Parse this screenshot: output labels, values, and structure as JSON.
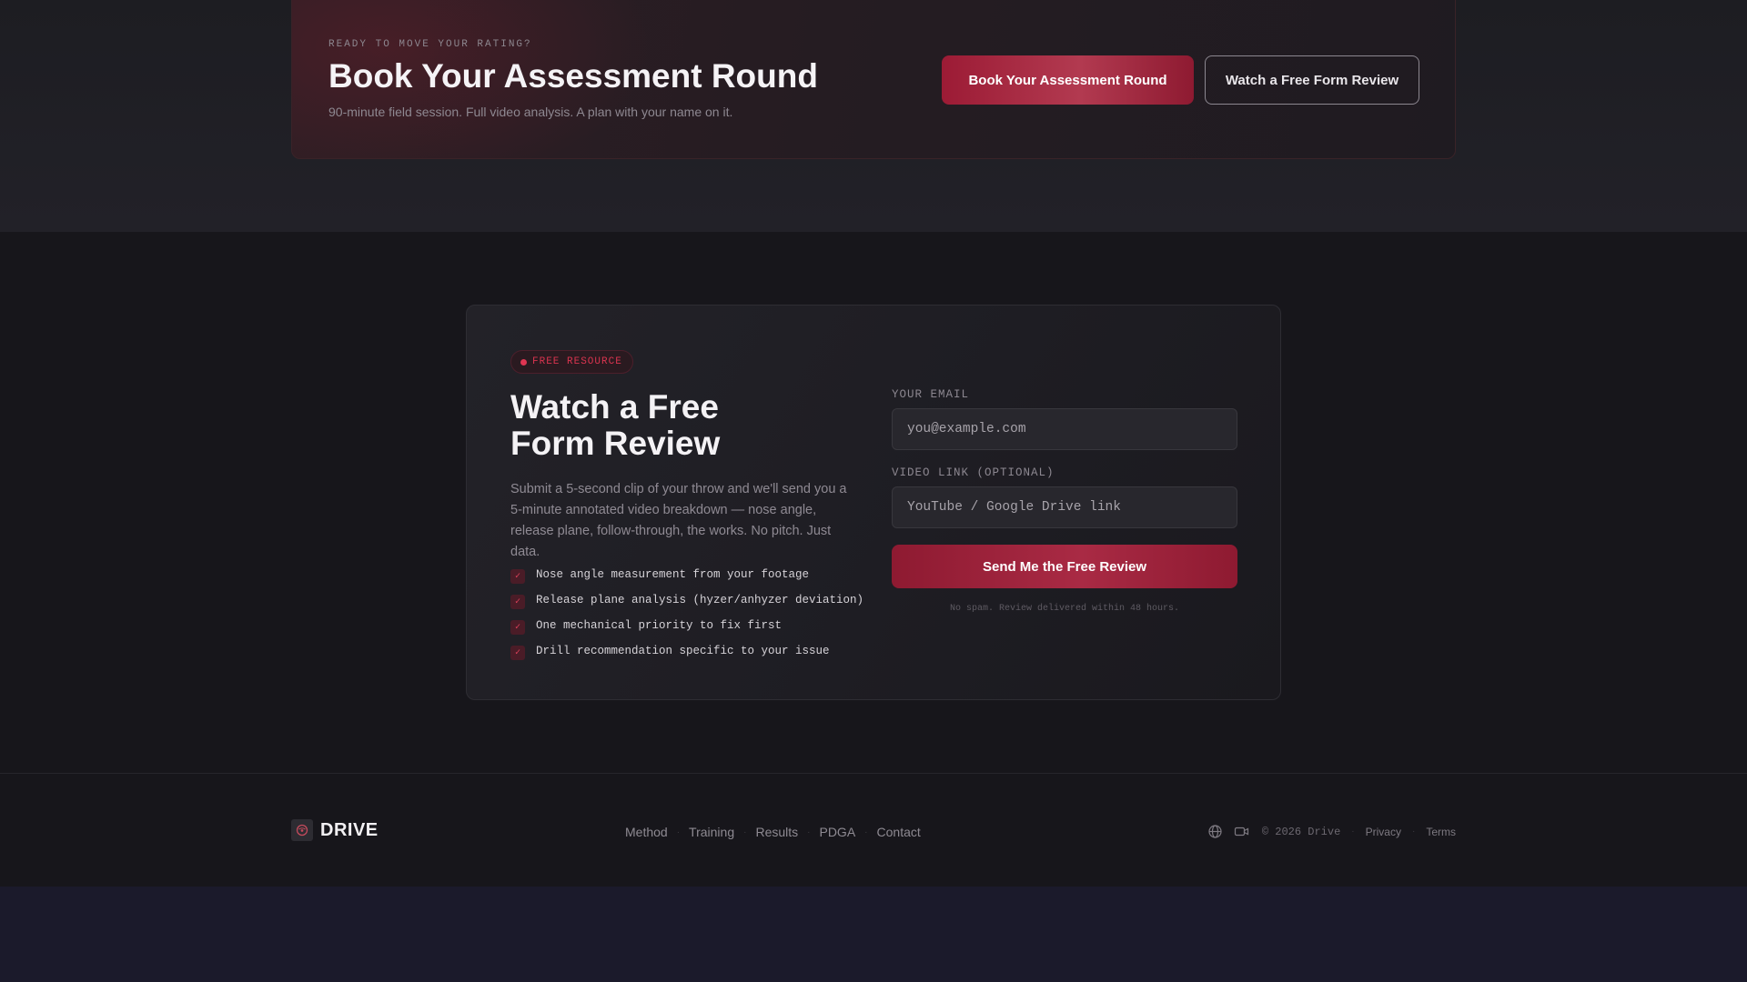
{
  "cta": {
    "eyebrow": "READY TO MOVE YOUR RATING?",
    "title": "Book Your Assessment Round",
    "subtitle": "90-minute field session. Full video analysis. A plan with your name on it.",
    "primary_button": "Book Your Assessment Round",
    "secondary_button": "Watch a Free Form Review",
    "accent_color": "#9c1b35"
  },
  "resource": {
    "badge": "FREE RESOURCE",
    "title": "Watch a Free Form Review",
    "description": "Submit a 5-second clip of your throw and we'll send you a 5-minute annotated video breakdown — nose angle, release plane, follow-through, the works. No pitch. Just data.",
    "checklist": [
      "Nose angle measurement from your footage",
      "Release plane analysis (hyzer/anhyzer deviation)",
      "One mechanical priority to fix first",
      "Drill recommendation specific to your issue"
    ],
    "form": {
      "email_label": "YOUR EMAIL",
      "email_placeholder": "you@example.com",
      "video_label": "VIDEO LINK (OPTIONAL)",
      "video_placeholder": "YouTube / Google Drive link",
      "submit_label": "Send Me the Free Review",
      "note": "No spam. Review delivered within 48 hours."
    }
  },
  "footer": {
    "logo_text": "DRIVE",
    "nav": [
      "Method",
      "Training",
      "Results",
      "PDGA",
      "Contact"
    ],
    "icons": [
      "globe-icon",
      "video-camera-icon"
    ],
    "copyright": "© 2026 Drive",
    "privacy": "Privacy",
    "terms": "Terms"
  }
}
